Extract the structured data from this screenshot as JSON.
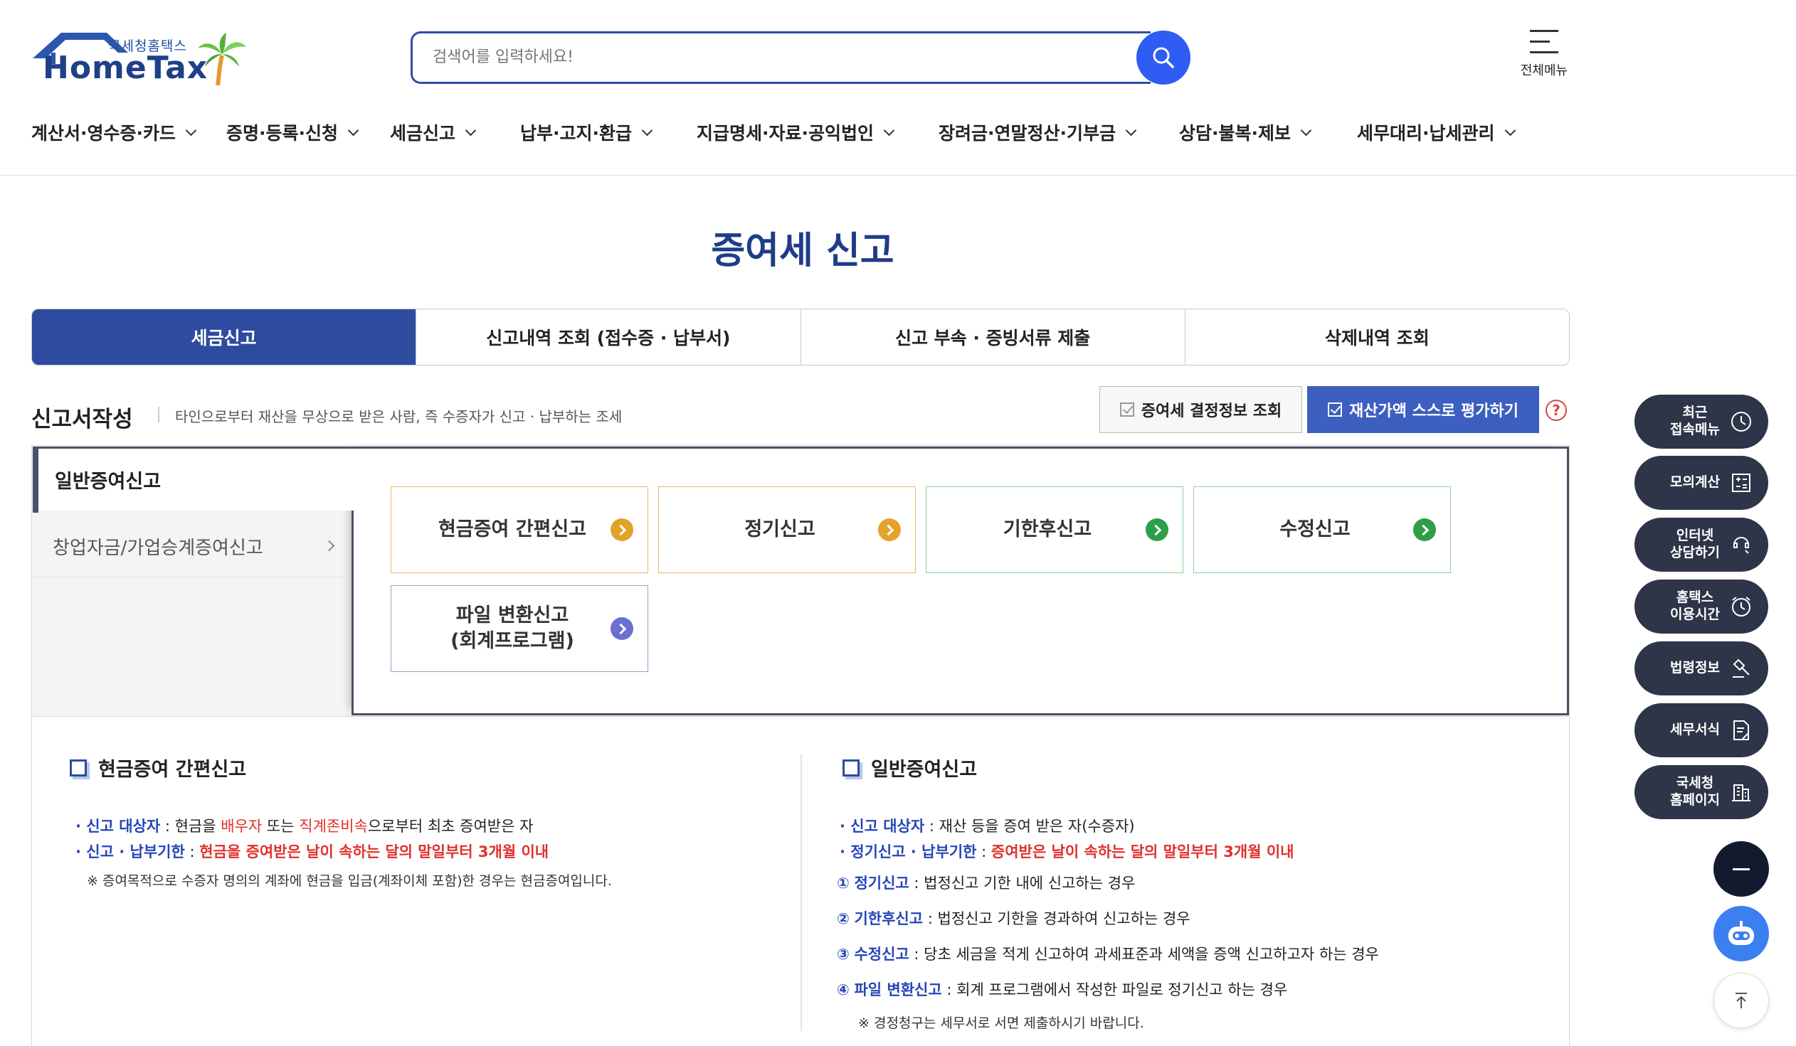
{
  "header": {
    "logo_sub": "국세청홈택스",
    "logo_main": "HomeTax",
    "search_placeholder": "검색어를 입력하세요!",
    "all_menu_label": "전체메뉴"
  },
  "gnb": [
    "계산서·영수증·카드",
    "증명·등록·신청",
    "세금신고",
    "납부·고지·환급",
    "지급명세·자료·공익법인",
    "장려금·연말정산·기부금",
    "상담·불복·제보",
    "세무대리·납세관리"
  ],
  "page_title": "증여세 신고",
  "tabs": [
    {
      "label": "세금신고",
      "active": true
    },
    {
      "label": "신고내역 조회 (접수증 · 납부서)",
      "active": false
    },
    {
      "label": "신고 부속 · 증빙서류 제출",
      "active": false
    },
    {
      "label": "삭제내역 조회",
      "active": false
    }
  ],
  "section": {
    "title": "신고서작성",
    "desc": "타인으로부터 재산을 무상으로 받은 사람, 즉 수증자가 신고 · 납부하는 조세",
    "btn_decision": "증여세 결정정보 조회",
    "btn_eval": "재산가액 스스로 평가하기",
    "help": "?"
  },
  "side": {
    "selected": "일반증여신고",
    "other": "창업자금/가업승계증여신고"
  },
  "cards": {
    "cash": "현금증여 간편신고",
    "regular": "정기신고",
    "late": "기한후신고",
    "amend": "수정신고",
    "file_line1": "파일 변환신고",
    "file_line2": "(회계프로그램)"
  },
  "info_left": {
    "title": "현금증여 간편신고",
    "l1_label": "신고 대상자",
    "l1_a": " : 현금을 ",
    "l1_b": "배우자",
    "l1_c": " 또는 ",
    "l1_d": "직계존비속",
    "l1_e": "으로부터 최초 증여받은 자",
    "l2_label": "신고 · 납부기한",
    "l2_a": " : ",
    "l2_b": "현금을 증여받은 날이 속하는 달의 말일부터 3개월 이내",
    "note": "※ 증여목적으로 수증자 명의의 계좌에 현금을 입금(계좌이체 포함)한 경우는 현금증여입니다."
  },
  "info_right": {
    "title": "일반증여신고",
    "l1_label": "신고 대상자",
    "l1_a": " : 재산 등을 증여 받은 자(수증자)",
    "l2_label": "정기신고 · 납부기한",
    "l2_a": " : ",
    "l2_b": "증여받은 날이 속하는 달의 말일부터 3개월 이내",
    "i1_num": "①",
    "i1_label": "정기신고",
    "i1_text": " : 법정신고 기한 내에 신고하는 경우",
    "i2_num": "②",
    "i2_label": "기한후신고",
    "i2_text": " : 법정신고 기한을 경과하여 신고하는 경우",
    "i3_num": "③",
    "i3_label": "수정신고",
    "i3_text": " : 당초 세금을 적게 신고하여 과세표준과 세액을 증액 신고하고자 하는 경우",
    "i4_num": "④",
    "i4_label": "파일 변환신고",
    "i4_text": " : 회계 프로그램에서 작성한 파일로 정기신고 하는 경우",
    "note": "※ 경정청구는 세무서로 서면 제출하시기 바랍니다."
  },
  "quick_menu": [
    {
      "line1": "최근",
      "line2": "접속메뉴",
      "icon": "clock-icon"
    },
    {
      "line1": "모의계산",
      "line2": "",
      "icon": "calculator-icon"
    },
    {
      "line1": "인터넷",
      "line2": "상담하기",
      "icon": "chat-icon"
    },
    {
      "line1": "홈택스",
      "line2": "이용시간",
      "icon": "alarm-icon"
    },
    {
      "line1": "법령정보",
      "line2": "",
      "icon": "gavel-icon"
    },
    {
      "line1": "세무서식",
      "line2": "",
      "icon": "document-icon"
    },
    {
      "line1": "국세청",
      "line2": "홈페이지",
      "icon": "building-icon"
    }
  ],
  "colors": {
    "brand_navy": "#2d4c9f",
    "search_blue": "#2f5cf2",
    "accent_red": "#e0302b",
    "quick_menu_bg": "#2e3548"
  }
}
